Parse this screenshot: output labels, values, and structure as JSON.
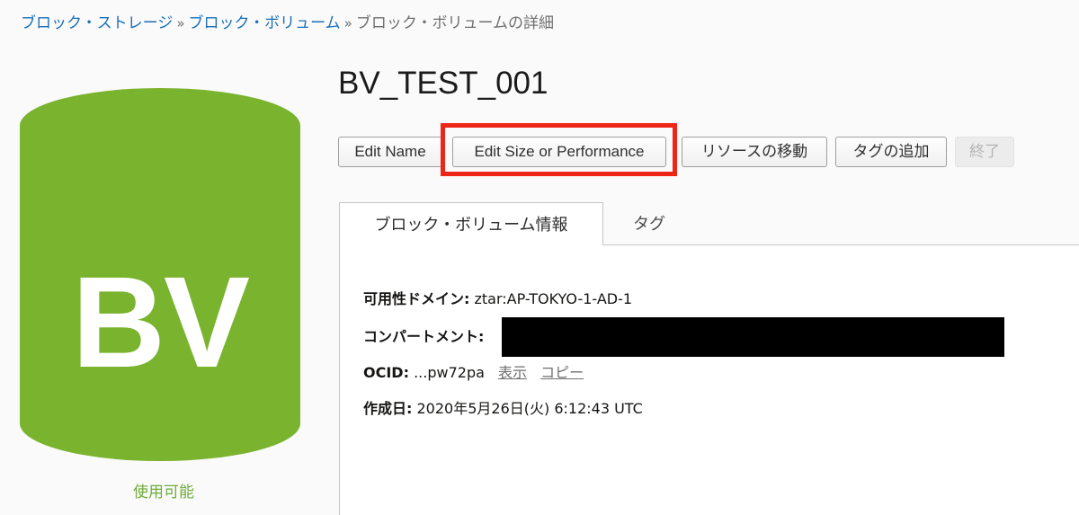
{
  "breadcrumb": {
    "items": [
      "ブロック・ストレージ",
      "ブロック・ボリューム"
    ],
    "current": "ブロック・ボリュームの詳細",
    "separator": "»"
  },
  "resource": {
    "badge_text": "BV",
    "status": "使用可能",
    "title": "BV_TEST_001"
  },
  "actions": {
    "edit_name": "Edit Name",
    "edit_size": "Edit Size or Performance",
    "move_resource": "リソースの移動",
    "add_tag": "タグの追加",
    "terminate": "終了"
  },
  "tabs": {
    "info": "ブロック・ボリューム情報",
    "tags": "タグ"
  },
  "details": {
    "ad_label": "可用性ドメイン:",
    "ad_value": "ztar:AP-TOKYO-1-AD-1",
    "compartment_label": "コンパートメント:",
    "ocid_label": "OCID:",
    "ocid_value": "...pw72pa",
    "ocid_show": "表示",
    "ocid_copy": "コピー",
    "created_label": "作成日:",
    "created_value": "2020年5月26日(火) 6:12:43 UTC"
  },
  "colors": {
    "accent_green": "#7ab32e",
    "link_blue": "#1a6fb8",
    "highlight_red": "#ee2618"
  }
}
